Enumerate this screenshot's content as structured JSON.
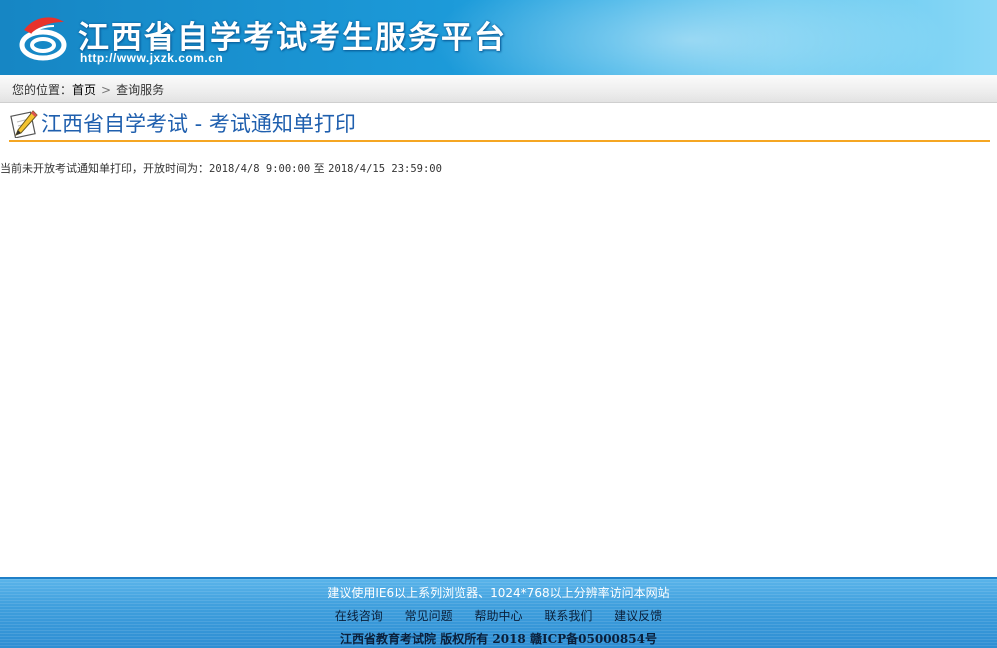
{
  "header": {
    "title": "江西省自学考试考生服务平台",
    "url": "http://www.jxzk.com.cn",
    "logo_icon": "swirl-logo-icon"
  },
  "breadcrumb": {
    "prefix": "您的位置：",
    "home": "首页",
    "separator": ">",
    "current": "查询服务"
  },
  "page": {
    "title": "江西省自学考试 - 考试通知单打印",
    "title_icon": "pencil-icon",
    "notice_text": "当前未开放考试通知单打印，开放时间为：",
    "open_start": "2018/4/8 9:00:00",
    "notice_to": "至",
    "open_end": "2018/4/15 23:59:00"
  },
  "footer": {
    "browser_tip": "建议使用IE6以上系列浏览器、1024*768以上分辨率访问本网站",
    "links": [
      "在线咨询",
      "常见问题",
      "帮助中心",
      "联系我们",
      "建议反馈"
    ],
    "copyright": "江西省教育考试院 版权所有 2018 赣ICP备05000854号"
  },
  "colors": {
    "header_blue": "#1c9ad9",
    "title_blue": "#1f5fae",
    "underline_orange": "#f5a623",
    "footer_blue": "#3f9fdd"
  }
}
